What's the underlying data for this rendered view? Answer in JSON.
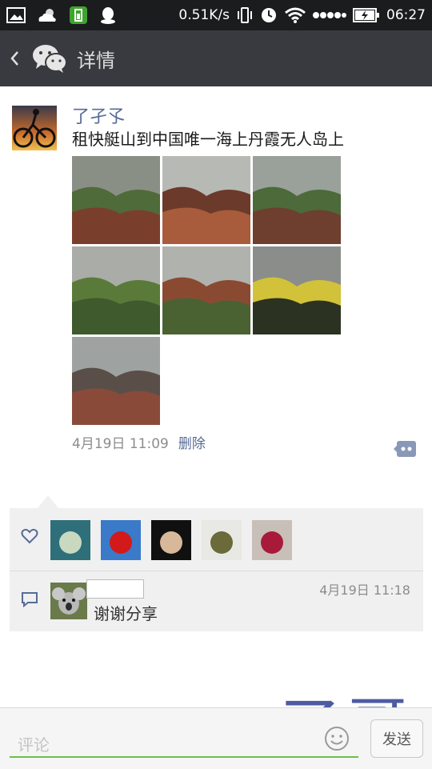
{
  "status_bar": {
    "network_speed": "0.51K/s",
    "time": "06:27",
    "icons": [
      "image-icon",
      "weather-icon",
      "battery-app-icon",
      "qq-icon",
      "vibrate-icon",
      "alarm-icon",
      "wifi-icon",
      "signal-icon",
      "battery-charging-icon"
    ]
  },
  "nav": {
    "title": "详情",
    "back_icon": "chevron-left-icon",
    "logo_icon": "wechat-logo-icon"
  },
  "post": {
    "username": "了孑孓",
    "text": "租快艇山到中国唯一海上丹霞无人岛上",
    "time": "4月19日 11:09",
    "delete_label": "删除",
    "photos": [
      {
        "name": "photo-hikers-rocks",
        "sky": "#8a8f86",
        "land": "#7a3f2c",
        "accent": "#4f6b3a"
      },
      {
        "name": "photo-red-rock-shore",
        "sky": "#b7b9b5",
        "land": "#a85c3c",
        "accent": "#6b3a2a"
      },
      {
        "name": "photo-hikers-slope",
        "sky": "#9aa09a",
        "land": "#6e3e2e",
        "accent": "#4c6a3a"
      },
      {
        "name": "photo-green-hill",
        "sky": "#a9aca7",
        "land": "#3f5a2c",
        "accent": "#5a7a3a"
      },
      {
        "name": "photo-hill-sea",
        "sky": "#b0b2ad",
        "land": "#4a6232",
        "accent": "#8a4a32"
      },
      {
        "name": "photo-cloudy-group",
        "sky": "#8b8d8a",
        "land": "#2c3222",
        "accent": "#d2c23a"
      },
      {
        "name": "photo-village-road",
        "sky": "#9ea3a2",
        "land": "#8a4a3a",
        "accent": "#5a4f48"
      }
    ]
  },
  "likes": {
    "icon": "heart-icon",
    "users": [
      {
        "name": "liker-1",
        "bg": "#2f6f7a",
        "fg": "#c8d9c0"
      },
      {
        "name": "liker-2",
        "bg": "#3a7ac8",
        "fg": "#d21a1a"
      },
      {
        "name": "liker-3",
        "bg": "#101010",
        "fg": "#d8b89a"
      },
      {
        "name": "liker-4",
        "bg": "#e8e8e4",
        "fg": "#6a6a3a"
      },
      {
        "name": "liker-5",
        "bg": "#c8c0b8",
        "fg": "#a81a3a"
      }
    ]
  },
  "comment": {
    "icon": "comment-bubble-icon",
    "time": "4月19日 11:18",
    "text": "谢谢分享"
  },
  "watermark": "了哥",
  "input": {
    "placeholder": "评论",
    "emoji_icon": "smiley-icon",
    "send_label": "发送"
  },
  "colors": {
    "link": "#576b95",
    "nav_bg": "#393a3f",
    "status_bg": "#1b1c1e",
    "input_underline": "#6cbf47"
  }
}
